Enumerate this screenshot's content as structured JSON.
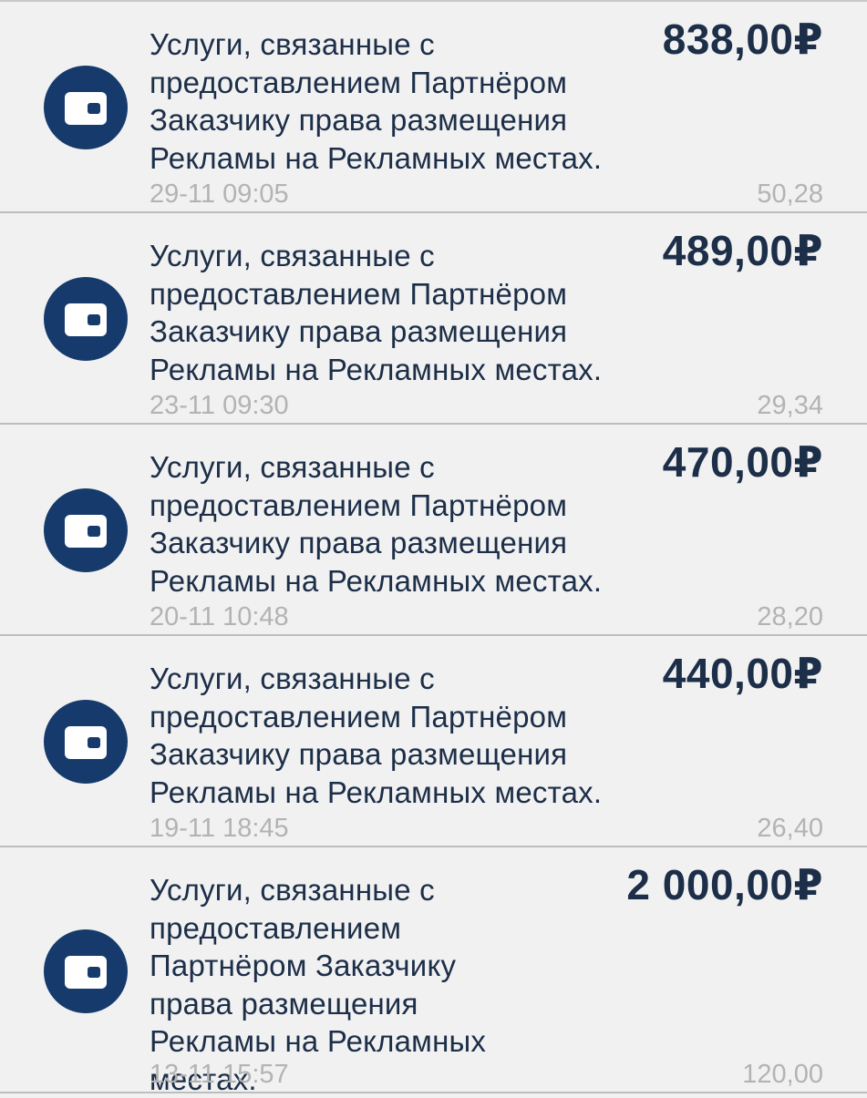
{
  "colors": {
    "background": "#f1f1f1",
    "icon_circle": "#153a6b",
    "primary_text": "#1c2e48",
    "secondary_text": "#b3b3b3",
    "divider": "#bdbdbd"
  },
  "transactions": [
    {
      "icon": "wallet-icon",
      "description": "Услуги, связанные с предоставлением Партнёром Заказчику права размещения Рекламы на Рекламных местах.",
      "amount": "838,00₽",
      "datetime": "29-11 09:05",
      "fee": "50,28"
    },
    {
      "icon": "wallet-icon",
      "description": "Услуги, связанные с предоставлением Партнёром Заказчику права размещения Рекламы на Рекламных местах.",
      "amount": "489,00₽",
      "datetime": "23-11 09:30",
      "fee": "29,34"
    },
    {
      "icon": "wallet-icon",
      "description": "Услуги, связанные с предоставлением Партнёром Заказчику права размещения Рекламы на Рекламных местах.",
      "amount": "470,00₽",
      "datetime": "20-11 10:48",
      "fee": "28,20"
    },
    {
      "icon": "wallet-icon",
      "description": "Услуги, связанные с предоставлением Партнёром Заказчику права размещения Рекламы на Рекламных местах.",
      "amount": "440,00₽",
      "datetime": "19-11 18:45",
      "fee": "26,40"
    },
    {
      "icon": "wallet-icon",
      "description": "Услуги, связанные с предоставлением Партнёром Заказчику права размещения Рекламы на Рекламных местах.",
      "amount": "2 000,00₽",
      "datetime": "13-11 15:57",
      "fee": "120,00"
    }
  ]
}
